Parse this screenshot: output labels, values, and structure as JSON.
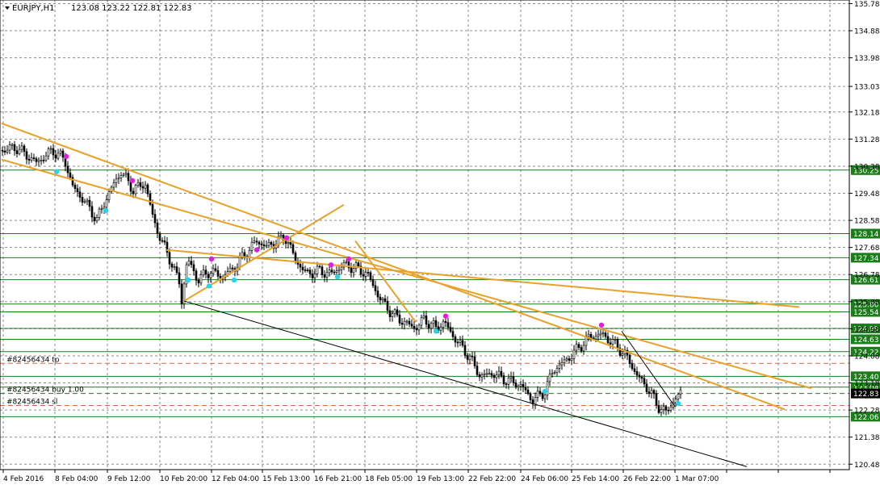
{
  "header": {
    "symbol": "EURJPY,H1",
    "ohlc": "123.08 123.22 122.81 122.83",
    "menu_icon": "triangle-down-icon"
  },
  "colors": {
    "background": "#ffffff",
    "grid": "#000000",
    "candle": "#000000",
    "trendline": "#e8a22a",
    "level_line": "#1a7d1a",
    "level_label_bg": "#1a7d1a",
    "level_label_text": "#ffffff",
    "current_price_bg": "#000000",
    "marker_high": "#e21ee2",
    "marker_low": "#2ad3ec",
    "order_tp": "#d5683b",
    "order_sl": "#d5683b",
    "order_entry": "#1a7d1a"
  },
  "chart_data": {
    "type": "candlestick",
    "symbol": "EURJPY",
    "timeframe": "H1",
    "grid": true,
    "ylim": [
      120.3,
      135.9
    ],
    "y_ticks": [
      "135.78",
      "134.88",
      "133.98",
      "133.03",
      "132.18",
      "131.28",
      "130.38",
      "129.48",
      "128.58",
      "127.68",
      "126.78",
      "125.88",
      "124.98",
      "124.08",
      "123.18",
      "122.28",
      "121.38",
      "120.48"
    ],
    "x_ticks": [
      "4 Feb 2016",
      "8 Feb 04:00",
      "9 Feb 12:00",
      "10 Feb 20:00",
      "12 Feb 04:00",
      "15 Feb 13:00",
      "16 Feb 21:00",
      "18 Feb 05:00",
      "19 Feb 13:00",
      "22 Feb 22:00",
      "24 Feb 06:00",
      "25 Feb 14:00",
      "26 Feb 22:00",
      "1 Mar 07:00"
    ],
    "price_path": [
      [
        0,
        130.9
      ],
      [
        20,
        131.0
      ],
      [
        45,
        130.5
      ],
      [
        65,
        130.9
      ],
      [
        80,
        130.6
      ],
      [
        90,
        129.7
      ],
      [
        105,
        129.2
      ],
      [
        120,
        128.6
      ],
      [
        135,
        129.5
      ],
      [
        150,
        130.2
      ],
      [
        165,
        129.6
      ],
      [
        180,
        129.8
      ],
      [
        190,
        128.6
      ],
      [
        200,
        127.9
      ],
      [
        212,
        127.2
      ],
      [
        222,
        126.5
      ],
      [
        225,
        125.9
      ],
      [
        232,
        127.3
      ],
      [
        245,
        126.6
      ],
      [
        260,
        126.9
      ],
      [
        275,
        126.7
      ],
      [
        290,
        127.0
      ],
      [
        305,
        127.5
      ],
      [
        318,
        127.9
      ],
      [
        330,
        127.7
      ],
      [
        345,
        127.9
      ],
      [
        355,
        128.0
      ],
      [
        365,
        127.3
      ],
      [
        380,
        126.8
      ],
      [
        395,
        126.9
      ],
      [
        410,
        126.8
      ],
      [
        425,
        127.1
      ],
      [
        440,
        127.0
      ],
      [
        455,
        126.8
      ],
      [
        470,
        126.0
      ],
      [
        485,
        125.5
      ],
      [
        500,
        125.2
      ],
      [
        515,
        125.0
      ],
      [
        525,
        125.3
      ],
      [
        540,
        125.0
      ],
      [
        550,
        125.2
      ],
      [
        565,
        124.6
      ],
      [
        580,
        124.1
      ],
      [
        595,
        123.4
      ],
      [
        610,
        123.5
      ],
      [
        625,
        123.3
      ],
      [
        645,
        123.1
      ],
      [
        660,
        122.6
      ],
      [
        675,
        122.9
      ],
      [
        685,
        123.6
      ],
      [
        700,
        123.9
      ],
      [
        715,
        124.3
      ],
      [
        730,
        124.7
      ],
      [
        745,
        124.8
      ],
      [
        760,
        124.5
      ],
      [
        775,
        124.1
      ],
      [
        790,
        123.4
      ],
      [
        805,
        122.9
      ],
      [
        815,
        122.4
      ],
      [
        825,
        122.2
      ],
      [
        835,
        122.6
      ],
      [
        845,
        122.9
      ]
    ],
    "levels": [
      {
        "price": "130.25",
        "label": "130.25",
        "role": "resistance"
      },
      {
        "price": "128.14",
        "label": "128.14",
        "role": "resistance"
      },
      {
        "price": "127.34",
        "label": "127.34",
        "role": "resistance"
      },
      {
        "price": "126.61",
        "label": "126.61",
        "role": "resistance"
      },
      {
        "price": "125.80",
        "label": "125.80",
        "role": "support"
      },
      {
        "price": "125.54",
        "label": "125.54",
        "role": "support"
      },
      {
        "price": "124.99",
        "label": "124.99",
        "role": "support"
      },
      {
        "price": "124.63",
        "label": "124.63",
        "role": "support"
      },
      {
        "price": "124.22",
        "label": "124.22",
        "role": "support"
      },
      {
        "price": "123.40",
        "label": "123.40",
        "role": "support"
      },
      {
        "price": "123.04",
        "label": "123.04",
        "role": "support"
      },
      {
        "price": "122.06",
        "label": "122.06",
        "role": "support"
      }
    ],
    "current_price": "122.83",
    "orders": [
      {
        "label": "#82456434 tp",
        "price": "123.83",
        "kind": "tp"
      },
      {
        "label": "#82456434 buy 1.00",
        "price": "122.83",
        "kind": "entry"
      },
      {
        "label": "#82456434 sl",
        "price": "122.43",
        "kind": "sl"
      }
    ],
    "trendlines": [
      {
        "name": "outer-upper-channel",
        "from": [
          2,
          131.8
        ],
        "to": [
          972,
          122.3
        ],
        "color": "#e8a22a"
      },
      {
        "name": "inner-upper-channel",
        "from": [
          2,
          130.6
        ],
        "to": [
          1005,
          123.0
        ],
        "color": "#e8a22a"
      },
      {
        "name": "long-flat-resistance",
        "from": [
          205,
          127.6
        ],
        "to": [
          990,
          125.7
        ],
        "color": "#e8a22a"
      },
      {
        "name": "rising-support",
        "from": [
          228,
          125.9
        ],
        "to": [
          426,
          129.1
        ],
        "color": "#e8a22a"
      },
      {
        "name": "steep-drop",
        "from": [
          440,
          127.9
        ],
        "to": [
          515,
          125.2
        ],
        "color": "#e8a22a"
      },
      {
        "name": "lower-channel",
        "from": [
          228,
          125.9
        ],
        "to": [
          925,
          120.4
        ],
        "color": "#000000"
      },
      {
        "name": "recent-downtrend",
        "from": [
          770,
          124.9
        ],
        "to": [
          836,
          122.4
        ],
        "color": "#000000"
      }
    ],
    "markers_high": [
      [
        82,
        130.7
      ],
      [
        164,
        129.9
      ],
      [
        262,
        127.3
      ],
      [
        318,
        127.6
      ],
      [
        355,
        128.0
      ],
      [
        410,
        127.1
      ],
      [
        432,
        127.3
      ],
      [
        552,
        125.4
      ],
      [
        745,
        125.1
      ]
    ],
    "markers_low": [
      [
        70,
        130.2
      ],
      [
        131,
        128.9
      ],
      [
        233,
        126.6
      ],
      [
        259,
        126.4
      ],
      [
        290,
        126.6
      ],
      [
        418,
        126.7
      ],
      [
        540,
        124.9
      ],
      [
        675,
        122.9
      ],
      [
        840,
        122.5
      ]
    ]
  }
}
